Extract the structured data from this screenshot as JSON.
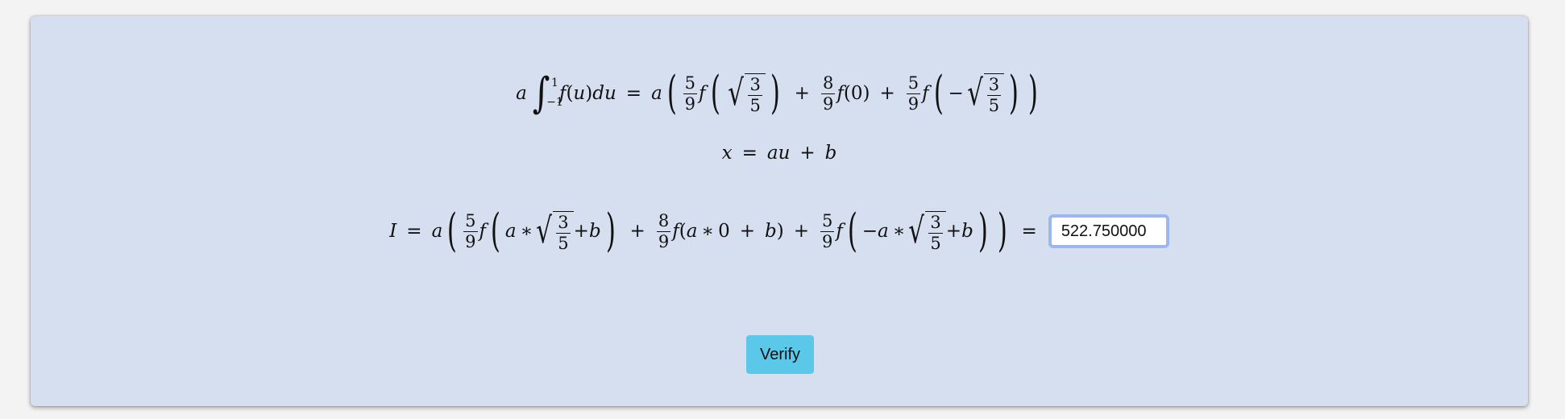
{
  "equations": {
    "quadrature_formula": "a ∫₋₁¹ f(u)du = a( 5/9 f(√(3/5)) + 8/9 f(0) + 5/9 f(−√(3/5)) )",
    "substitution": "x = au + b",
    "integral_expression": "I = a( 5/9 f(a∗√(3/5)+b) + 8/9 f(a∗0 + b) + 5/9 f(−a∗√(3/5)+b) ) ="
  },
  "answer": {
    "value": "522.750000",
    "placeholder": ""
  },
  "verify_button": {
    "label": "Verify"
  },
  "colors": {
    "panel_background": "#d6dff0",
    "button_background": "#5bc8ea",
    "input_focus_border": "#9bb7ee"
  }
}
